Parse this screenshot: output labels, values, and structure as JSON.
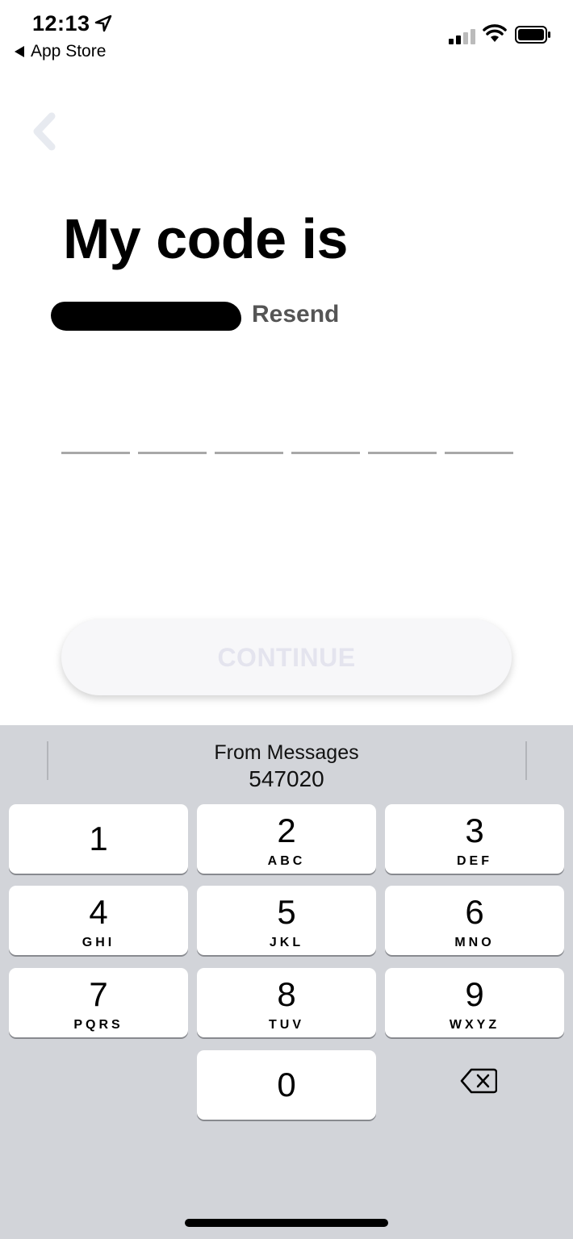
{
  "status_bar": {
    "time": "12:13",
    "back_app": "App Store"
  },
  "page": {
    "title": "My code is",
    "resend_label": "Resend",
    "code_slot_count": 6,
    "continue_label": "CONTINUE"
  },
  "keyboard": {
    "suggestion_source": "From Messages",
    "suggestion_code": "547020",
    "keys": [
      {
        "digit": "1",
        "letters": ""
      },
      {
        "digit": "2",
        "letters": "ABC"
      },
      {
        "digit": "3",
        "letters": "DEF"
      },
      {
        "digit": "4",
        "letters": "GHI"
      },
      {
        "digit": "5",
        "letters": "JKL"
      },
      {
        "digit": "6",
        "letters": "MNO"
      },
      {
        "digit": "7",
        "letters": "PQRS"
      },
      {
        "digit": "8",
        "letters": "TUV"
      },
      {
        "digit": "9",
        "letters": "WXYZ"
      },
      {
        "digit": "0",
        "letters": ""
      }
    ]
  },
  "icons": [
    "location-arrow-icon",
    "signal-icon",
    "wifi-icon",
    "battery-icon",
    "chevron-left-icon",
    "delete-icon"
  ],
  "colors": {
    "keyboard_bg": "#d2d4d9",
    "resend_text": "#555555",
    "continue_disabled_text": "#e4e4ee"
  }
}
